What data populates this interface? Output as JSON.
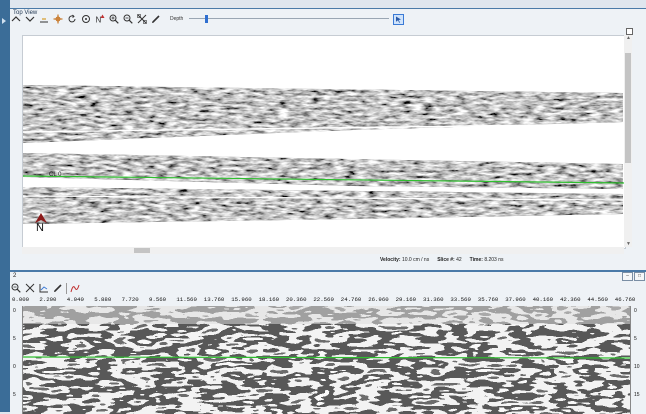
{
  "top_view": {
    "title": "Top View",
    "depth_label": "Depth",
    "depth_value": 0.08,
    "marker_label": "CL 0",
    "north_label": "N",
    "status": {
      "velocity_label": "Velocity:",
      "velocity_value": "10.0 cm / ns",
      "slice_label": "Slice #:",
      "slice_value": "42",
      "time_label": "Time:",
      "time_value": "8.203 ns"
    },
    "toolbar_icons": [
      "chevron-up-icon",
      "chevron-down-icon",
      "baseline-icon",
      "move-icon",
      "rotate-icon",
      "rotate-ccw-icon",
      "north-icon",
      "zoom-in-icon",
      "zoom-out-icon",
      "fit-icon",
      "pencil-icon"
    ]
  },
  "bottom_view": {
    "title": "2",
    "minimize": "–",
    "restore": "□",
    "x_ticks": [
      "0.000",
      "2.200",
      "4.040",
      "5.880",
      "7.720",
      "9.560",
      "11.560",
      "13.760",
      "15.960",
      "18.160",
      "20.360",
      "22.560",
      "24.760",
      "26.960",
      "29.160",
      "31.360",
      "33.560",
      "35.760",
      "37.960",
      "40.160",
      "42.360",
      "44.560",
      "46.760"
    ],
    "y_ticks_left": [
      "0",
      "5",
      "0",
      "5"
    ],
    "y_ticks_right": [
      "0",
      "5",
      "10",
      "15"
    ],
    "toolbar_icons": [
      "zoom-out-icon",
      "fit-icon",
      "chart-icon",
      "pencil-icon",
      "trace-icon"
    ]
  },
  "colors": {
    "accent": "#3b6d98",
    "pick_line": "#2fbf2f",
    "slider_thumb": "#2f6fd0"
  }
}
